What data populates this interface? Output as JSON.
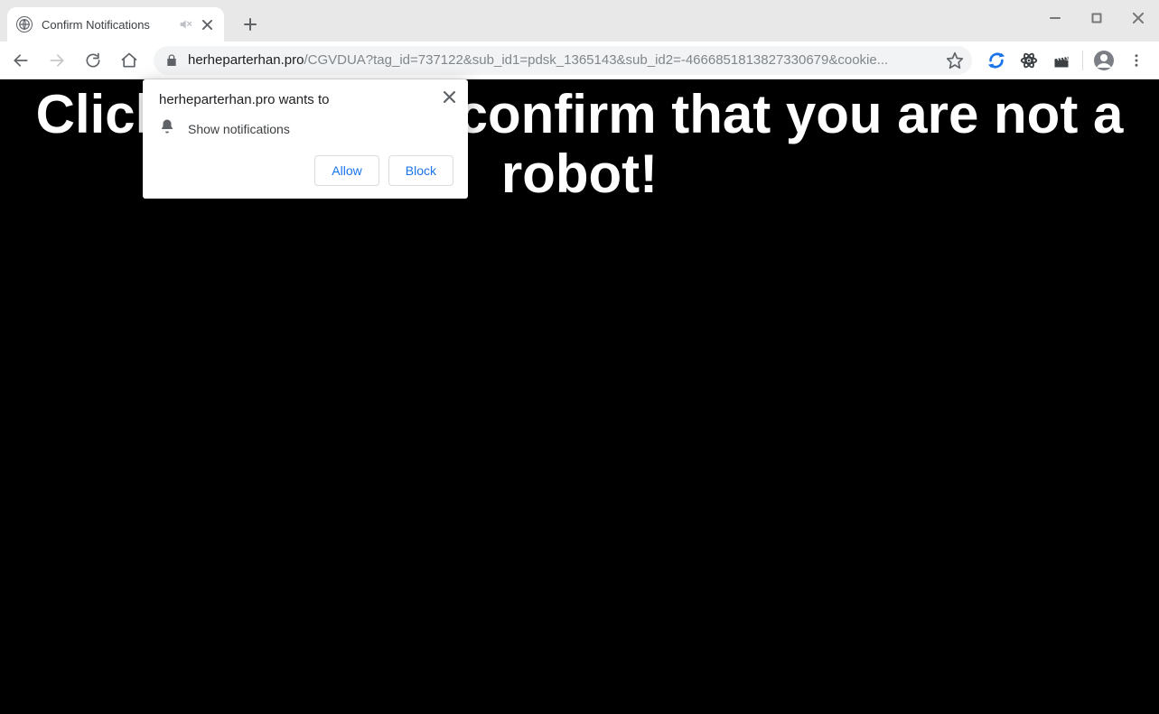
{
  "window_controls": {
    "minimize": "minimize",
    "maximize": "maximize",
    "close": "close"
  },
  "tab": {
    "title": "Confirm Notifications",
    "audio_muted": true
  },
  "omnibox": {
    "host": "herheparterhan.pro",
    "path": "/CGVDUA?tag_id=737122&sub_id1=pdsk_1365143&sub_id2=-4666851813827330679&cookie..."
  },
  "page": {
    "heading": "Click \"Allow\" to confirm that you are not a robot!"
  },
  "permission_popup": {
    "title": "herheparterhan.pro wants to",
    "item_label": "Show notifications",
    "allow_label": "Allow",
    "block_label": "Block"
  }
}
